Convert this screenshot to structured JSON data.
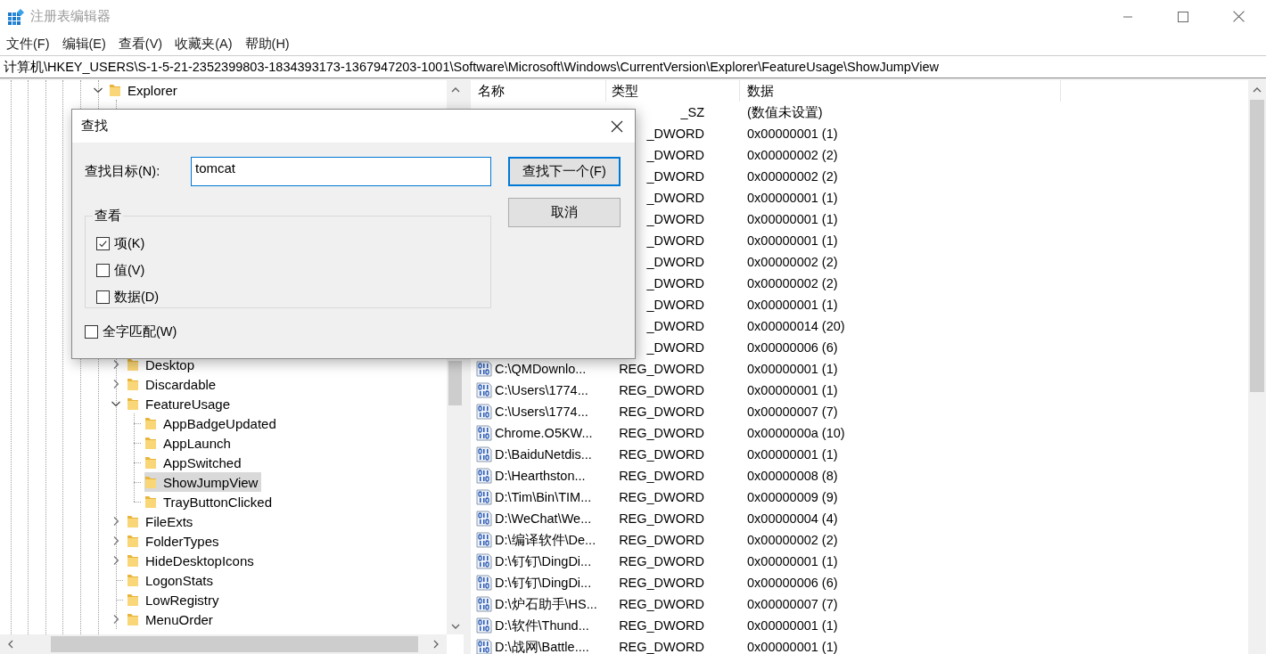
{
  "window": {
    "title": "注册表编辑器"
  },
  "menu": [
    "文件(F)",
    "编辑(E)",
    "查看(V)",
    "收藏夹(A)",
    "帮助(H)"
  ],
  "address": "计算机\\HKEY_USERS\\S-1-5-21-2352399803-1834393173-1367947203-1001\\Software\\Microsoft\\Windows\\CurrentVersion\\Explorer\\FeatureUsage\\ShowJumpView",
  "tree": [
    {
      "label": "Explorer",
      "expanded": true,
      "selected": false,
      "children": [
        {
          "label": "Desktop",
          "expanded": false,
          "selected": false
        },
        {
          "label": "Discardable",
          "expanded": false,
          "selected": false
        },
        {
          "label": "FeatureUsage",
          "expanded": true,
          "selected": false,
          "children": [
            {
              "label": "AppBadgeUpdated",
              "selected": false
            },
            {
              "label": "AppLaunch",
              "selected": false
            },
            {
              "label": "AppSwitched",
              "selected": false
            },
            {
              "label": "ShowJumpView",
              "selected": true
            },
            {
              "label": "TrayButtonClicked",
              "selected": false
            }
          ]
        },
        {
          "label": "FileExts",
          "expanded": false,
          "selected": false
        },
        {
          "label": "FolderTypes",
          "expanded": false,
          "selected": false
        },
        {
          "label": "HideDesktopIcons",
          "expanded": false,
          "selected": false
        },
        {
          "label": "LogonStats",
          "selected": false
        },
        {
          "label": "LowRegistry",
          "selected": false
        },
        {
          "label": "MenuOrder",
          "expanded": false,
          "selected": false
        }
      ]
    }
  ],
  "list": {
    "columns": [
      "名称",
      "类型",
      "数据"
    ],
    "rows": [
      {
        "type": "_SZ",
        "data": "(数值未设置)"
      },
      {
        "type": "_DWORD",
        "data": "0x00000001 (1)"
      },
      {
        "type": "_DWORD",
        "data": "0x00000002 (2)"
      },
      {
        "type": "_DWORD",
        "data": "0x00000002 (2)"
      },
      {
        "type": "_DWORD",
        "data": "0x00000001 (1)"
      },
      {
        "type": "_DWORD",
        "data": "0x00000001 (1)"
      },
      {
        "type": "_DWORD",
        "data": "0x00000001 (1)"
      },
      {
        "type": "_DWORD",
        "data": "0x00000002 (2)"
      },
      {
        "type": "_DWORD",
        "data": "0x00000002 (2)"
      },
      {
        "type": "_DWORD",
        "data": "0x00000001 (1)"
      },
      {
        "type": "_DWORD",
        "data": "0x00000014 (20)"
      },
      {
        "type": "_DWORD",
        "data": "0x00000006 (6)"
      },
      {
        "name": "C:\\QMDownlo...",
        "type": "REG_DWORD",
        "data": "0x00000001 (1)"
      },
      {
        "name": "C:\\Users\\1774...",
        "type": "REG_DWORD",
        "data": "0x00000001 (1)"
      },
      {
        "name": "C:\\Users\\1774...",
        "type": "REG_DWORD",
        "data": "0x00000007 (7)"
      },
      {
        "name": "Chrome.O5KW...",
        "type": "REG_DWORD",
        "data": "0x0000000a (10)"
      },
      {
        "name": "D:\\BaiduNetdis...",
        "type": "REG_DWORD",
        "data": "0x00000001 (1)"
      },
      {
        "name": "D:\\Hearthston...",
        "type": "REG_DWORD",
        "data": "0x00000008 (8)"
      },
      {
        "name": "D:\\Tim\\Bin\\TIM...",
        "type": "REG_DWORD",
        "data": "0x00000009 (9)"
      },
      {
        "name": "D:\\WeChat\\We...",
        "type": "REG_DWORD",
        "data": "0x00000004 (4)"
      },
      {
        "name": "D:\\编译软件\\De...",
        "type": "REG_DWORD",
        "data": "0x00000002 (2)"
      },
      {
        "name": "D:\\钉钉\\DingDi...",
        "type": "REG_DWORD",
        "data": "0x00000001 (1)"
      },
      {
        "name": "D:\\钉钉\\DingDi...",
        "type": "REG_DWORD",
        "data": "0x00000006 (6)"
      },
      {
        "name": "D:\\炉石助手\\HS...",
        "type": "REG_DWORD",
        "data": "0x00000007 (7)"
      },
      {
        "name": "D:\\软件\\Thund...",
        "type": "REG_DWORD",
        "data": "0x00000001 (1)"
      },
      {
        "name": "D:\\战网\\Battle....",
        "type": "REG_DWORD",
        "data": "0x00000001 (1)"
      }
    ]
  },
  "find_dialog": {
    "title": "查找",
    "target_label": "查找目标(N):",
    "target_value": "tomcat",
    "find_next": "查找下一个(F)",
    "cancel": "取消",
    "look_at": {
      "label": "查看",
      "options": [
        {
          "label": "项(K)",
          "checked": true
        },
        {
          "label": "值(V)",
          "checked": false
        },
        {
          "label": "数据(D)",
          "checked": false
        }
      ]
    },
    "whole_word": {
      "label": "全字匹配(W)",
      "checked": false
    }
  }
}
